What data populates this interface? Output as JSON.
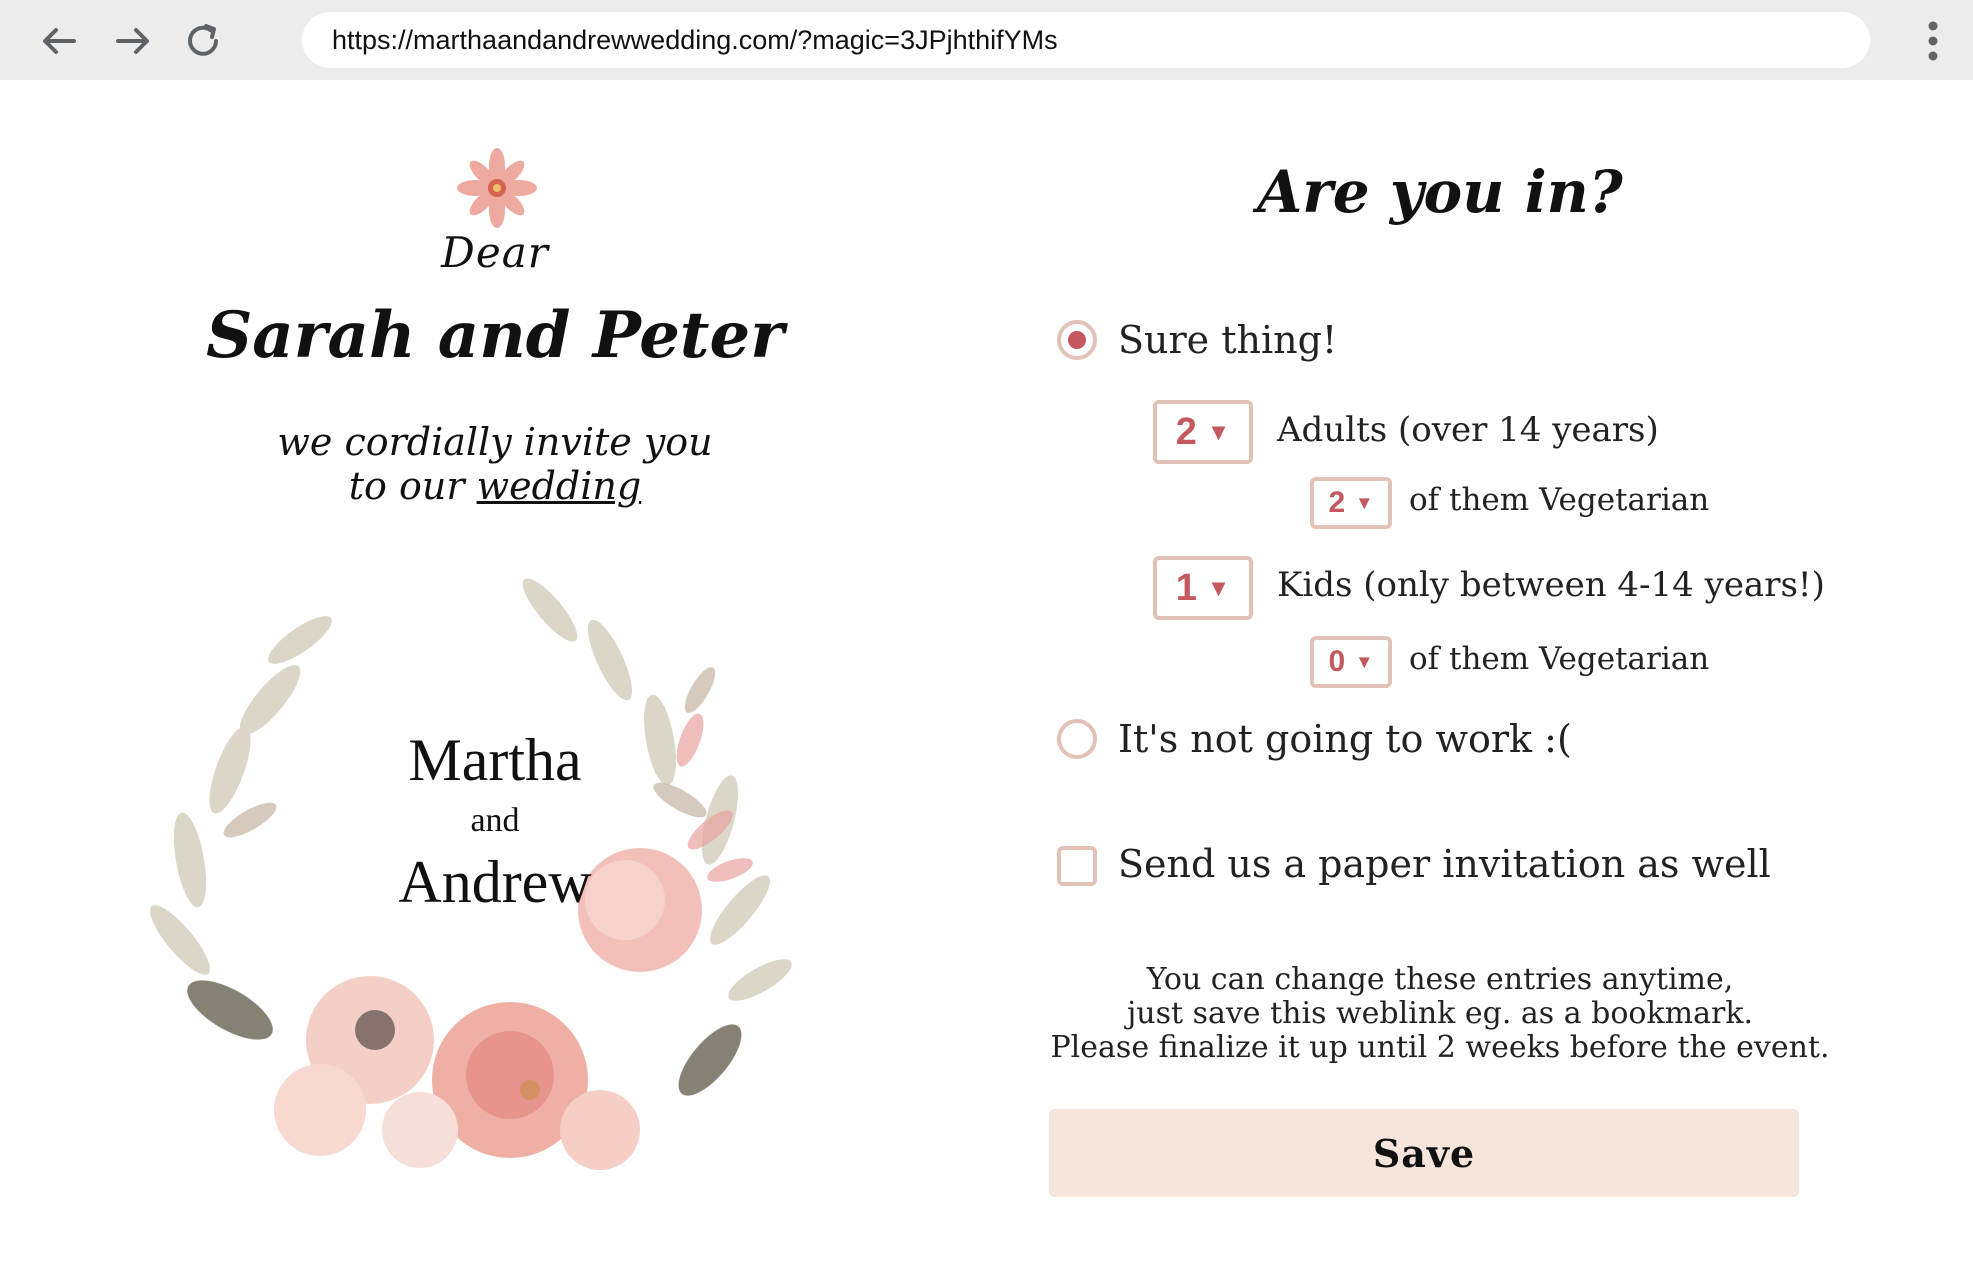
{
  "browser": {
    "url": "https://marthaandandrewwedding.com/?magic=3JPjhthifYMs",
    "icons": [
      "back-arrow-icon",
      "forward-arrow-icon",
      "reload-icon",
      "more-vert-icon"
    ]
  },
  "invitation": {
    "greeting": "Dear",
    "guests": "Sarah and Peter",
    "invite_line1": "we cordially invite you",
    "invite_line2_prefix": "to our ",
    "invite_line2_word": "wedding",
    "couple_name1": "Martha",
    "couple_and": "and",
    "couple_name2": "Andrew"
  },
  "rsvp": {
    "title": "Are you in?",
    "option_yes": "Sure thing!",
    "adults_count": "2",
    "adults_label": "Adults (over 14 years)",
    "adults_veg_count": "2",
    "adults_veg_label": "of them Vegetarian",
    "kids_count": "1",
    "kids_label": "Kids (only between 4-14 years!)",
    "kids_veg_count": "0",
    "kids_veg_label": "of them Vegetarian",
    "option_no": "It's not going to work :(",
    "paper_invite_label": "Send us a paper invitation  as well",
    "note_line1": "You can change these entries anytime,",
    "note_line2": "just save this weblink eg. as a bookmark.",
    "note_line3": "Please finalize it up until 2 weeks before the event.",
    "save_label": "Save"
  },
  "colors": {
    "accent": "#c5585e",
    "border": "#e2c1b6",
    "button_bg": "#f7e4da"
  }
}
